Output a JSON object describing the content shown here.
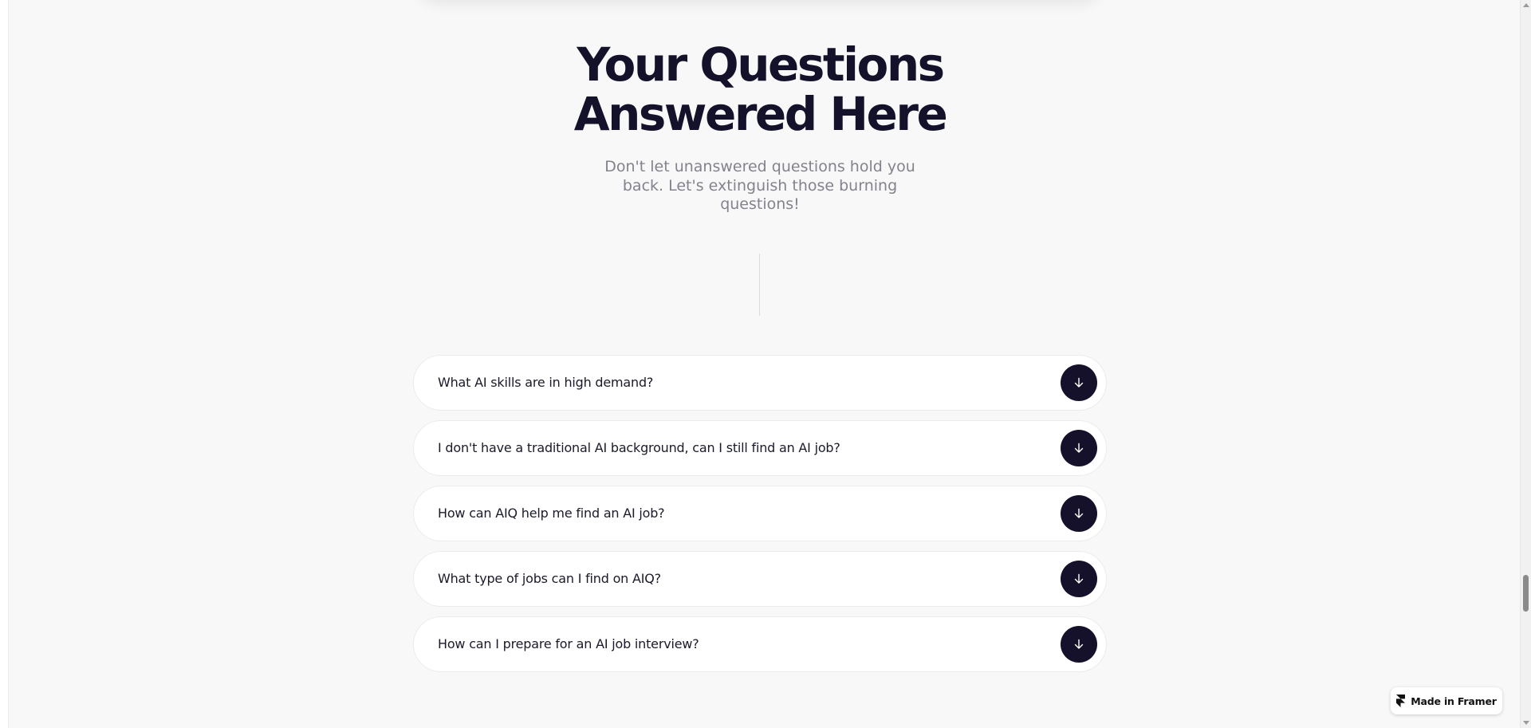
{
  "faq_section": {
    "title_line1": "Your Questions",
    "title_line2": "Answered Here",
    "subtitle": "Don't let unanswered questions hold you back. Let's extinguish those burning questions!"
  },
  "faq_items": [
    {
      "question": "What AI skills are in high demand?",
      "icon": "arrow-down-icon"
    },
    {
      "question": "I don't have a traditional AI background, can I still find an AI job?",
      "icon": "arrow-down-icon"
    },
    {
      "question": "How can AIQ help me find an AI job?",
      "icon": "arrow-down-icon"
    },
    {
      "question": "What type of jobs can I find on AIQ?",
      "icon": "arrow-down-icon"
    },
    {
      "question": "How can I prepare for an AI job interview?",
      "icon": "arrow-down-icon"
    }
  ],
  "badge": {
    "label": "Made in Framer",
    "icon": "framer-logo-icon"
  },
  "colors": {
    "page_background": "#f8f8f8",
    "title": "#14122b",
    "subtitle": "#83828d",
    "toggle_button": "#15112a",
    "card_background": "#ffffff"
  }
}
